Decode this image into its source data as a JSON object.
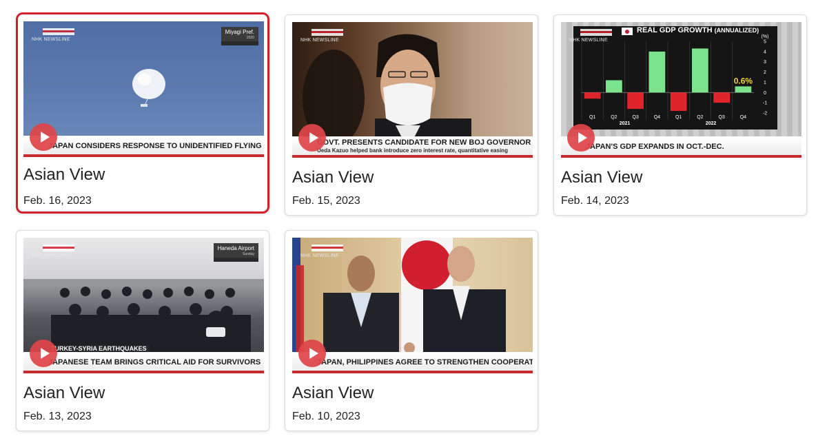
{
  "cards": [
    {
      "title": "Asian View",
      "date": "Feb. 16, 2023",
      "selected": true,
      "thumbnail": {
        "scene": "balloon-sky",
        "logo_text": "NHK NEWSLINE",
        "location": "Miyagi Pref.",
        "location_sub": "2020",
        "caption": "JAPAN CONSIDERS RESPONSE TO UNIDENTIFIED FLYING OBJECTS"
      }
    },
    {
      "title": "Asian View",
      "date": "Feb. 15, 2023",
      "selected": false,
      "thumbnail": {
        "scene": "man-in-mask",
        "logo_text": "NHK NEWSLINE",
        "caption": "GOVT. PRESENTS CANDIDATE FOR NEW BOJ GOVERNOR",
        "caption_sub": "Ueda Kazuo helped bank introduce zero interest rate, quantitative easing"
      }
    },
    {
      "title": "Asian View",
      "date": "Feb. 14, 2023",
      "selected": false,
      "thumbnail": {
        "scene": "gdp-chart",
        "logo_text": "NHK NEWSLINE",
        "chart_title": "REAL GDP GROWTH",
        "chart_title_suffix": "(ANNUALIZED)",
        "unit": "(%)",
        "yticks": [
          "5",
          "4",
          "3",
          "2",
          "1",
          "0",
          "-1",
          "-2"
        ],
        "year_labels": [
          "2021",
          "2022"
        ],
        "last_value_label": "0.6%",
        "caption": "JAPAN'S GDP EXPANDS IN OCT.-DEC."
      }
    },
    {
      "title": "Asian View",
      "date": "Feb. 13, 2023",
      "selected": false,
      "thumbnail": {
        "scene": "rescue-team",
        "logo_text": "NHK NEWSLINE",
        "location": "Haneda Airport",
        "location_sub": "Sunday",
        "caption_tag": "TURKEY-SYRIA EARTHQUAKES",
        "caption": "JAPANESE TEAM BRINGS CRITICAL AID FOR SURVIVORS"
      }
    },
    {
      "title": "Asian View",
      "date": "Feb. 10, 2023",
      "selected": false,
      "thumbnail": {
        "scene": "handshake",
        "logo_text": "NHK NEWSLINE",
        "caption": "JAPAN, PHILIPPINES AGREE TO STRENGTHEN COOPERATION"
      }
    }
  ],
  "chart_data": {
    "type": "bar",
    "title": "REAL GDP GROWTH (ANNUALIZED)",
    "ylabel": "(%)",
    "categories": [
      "Q1",
      "Q2",
      "Q3",
      "Q4",
      "Q1",
      "Q2",
      "Q3",
      "Q4"
    ],
    "groups": [
      "2021",
      "2021",
      "2021",
      "2021",
      "2022",
      "2022",
      "2022",
      "2022"
    ],
    "values": [
      -0.6,
      1.2,
      -1.6,
      4.0,
      -1.8,
      4.3,
      -1.0,
      0.6
    ],
    "ylim": [
      -2,
      5
    ],
    "colors": {
      "positive": "#7be38b",
      "negative": "#e0242c"
    }
  },
  "colors": {
    "accent": "#d21f2b",
    "play": "#e0454a"
  }
}
